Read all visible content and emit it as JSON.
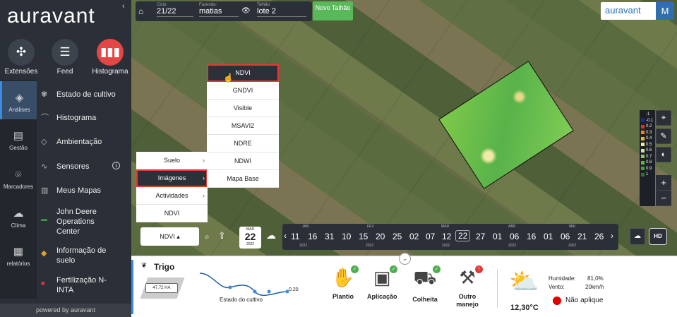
{
  "sidebar": {
    "logo": "auravant",
    "collapse_icon": "chevron-left-icon",
    "apps": [
      {
        "label": "Extensões",
        "icon": "puzzle-icon"
      },
      {
        "label": "Feed",
        "icon": "message-icon"
      },
      {
        "label": "Histograma",
        "icon": "histogram-icon"
      }
    ],
    "nav": [
      {
        "label": "Análises",
        "icon": "layers-icon"
      },
      {
        "label": "Gestão",
        "icon": "notebook-icon"
      },
      {
        "label": "Marcadores",
        "icon": "pin-icon"
      },
      {
        "label": "Clima",
        "icon": "cloud-icon"
      },
      {
        "label": "relatórios",
        "icon": "report-icon"
      }
    ],
    "menu": [
      {
        "label": "Estado de cultivo",
        "icon": "sprout-icon"
      },
      {
        "label": "Histograma",
        "icon": "curve-icon"
      },
      {
        "label": "Ambientação",
        "icon": "stack-icon"
      },
      {
        "label": "Sensores",
        "icon": "wave-icon",
        "badge": "i"
      },
      {
        "label": "Meus Mapas",
        "icon": "map-icon"
      },
      {
        "label": "John Deere Operations Center",
        "icon": "john-deere-icon"
      },
      {
        "label": "Informação de suelo",
        "icon": "soil-layers-icon"
      },
      {
        "label": "Fertilização N-INTA",
        "icon": "inta-icon"
      }
    ],
    "powered": "powered by auravant"
  },
  "topbar": {
    "ciclo_caption": "Ciclo:",
    "ciclo_value": "21/22",
    "fazenda_caption": "Fazenda:",
    "fazenda_value": "matias",
    "talhao_caption": "Talhão:",
    "talhao_value": "lote 2",
    "novo_label": "Novo Talhão"
  },
  "brand": {
    "word": "auravant",
    "user_initial": "M"
  },
  "legend": [
    {
      "v": "-1",
      "c": "#1a1a1a"
    },
    {
      "v": "-0.1",
      "c": "#1b2a9c"
    },
    {
      "v": "0.2",
      "c": "#d8332c"
    },
    {
      "v": "0.3",
      "c": "#e58a2b"
    },
    {
      "v": "0.4",
      "c": "#e9b23a"
    },
    {
      "v": "0.5",
      "c": "#f3e8a8"
    },
    {
      "v": "0.6",
      "c": "#cfe49a"
    },
    {
      "v": "0.7",
      "c": "#8fc85c"
    },
    {
      "v": "0.8",
      "c": "#62b449"
    },
    {
      "v": "0.9",
      "c": "#3e9e3b"
    },
    {
      "v": "1",
      "c": "#217c2c"
    }
  ],
  "layers_menu": {
    "main": [
      {
        "label": "Suelo",
        "arrow": "›"
      },
      {
        "label": "Imágenes",
        "arrow": "›"
      },
      {
        "label": "Actividades",
        "arrow": "›"
      },
      {
        "label": "NDVI",
        "arrow": ""
      }
    ],
    "sub": [
      "NDVI",
      "GNDVI",
      "Visible",
      "MSAVI2",
      "NDRE",
      "NDWI",
      "Mapa Base"
    ]
  },
  "timeline": {
    "layer_button": "NDVI ▴",
    "date": {
      "month": "MAR",
      "day": "22",
      "year": "2022"
    },
    "months": [
      "JAN",
      "FEV",
      "MAR",
      "ABR",
      "MAI"
    ],
    "days": [
      "11",
      "16",
      "31",
      "10",
      "15",
      "20",
      "25",
      "02",
      "07",
      "12",
      "22",
      "27",
      "01",
      "06",
      "16",
      "01",
      "06",
      "21",
      "26"
    ],
    "years": [
      "2022",
      "2022",
      "2022",
      "2022",
      "2022"
    ],
    "hd_label": "HD"
  },
  "bottom": {
    "crop": "Trigo",
    "area": "47.72 HA",
    "state_label": "Estado do cultivo",
    "state_value": "0.20",
    "stages": [
      {
        "label": "Plantio",
        "icon": "planting-icon",
        "status": "ok"
      },
      {
        "label": "Aplicação",
        "icon": "application-icon",
        "status": "ok"
      },
      {
        "label": "Colheita",
        "icon": "harvester-icon",
        "status": "ok"
      },
      {
        "label": "Outro manejo",
        "icon": "shovel-icon",
        "status": "warn"
      }
    ],
    "weather": {
      "temp": "12,30°C",
      "humidity_label": "Humidade:",
      "humidity": "81,0%",
      "wind_label": "Vento:",
      "wind": "20km/h",
      "advice": "Não aplique"
    }
  }
}
